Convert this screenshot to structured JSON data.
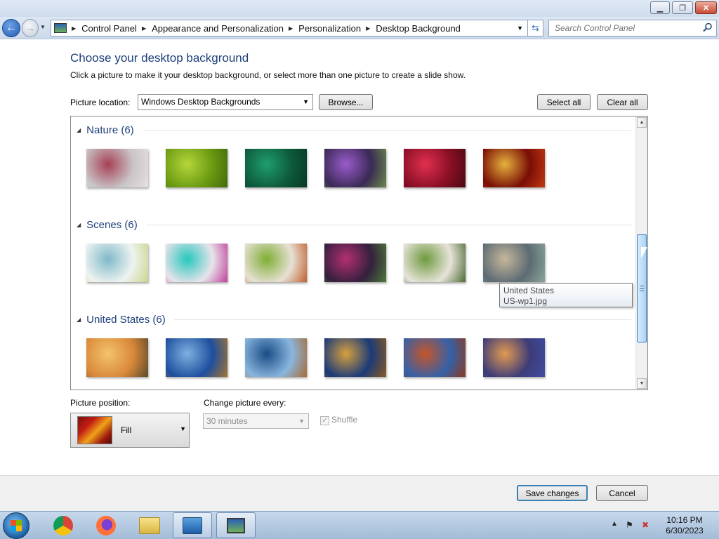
{
  "window": {
    "minimize_label": "▁",
    "maximize_label": "❐",
    "close_label": "✕"
  },
  "address": {
    "breadcrumbs": [
      "Control Panel",
      "Appearance and Personalization",
      "Personalization",
      "Desktop Background"
    ],
    "search_placeholder": "Search Control Panel"
  },
  "main": {
    "heading": "Choose your desktop background",
    "subtext": "Click a picture to make it your desktop background, or select more than one picture to create a slide show.",
    "location_label": "Picture location:",
    "location_value": "Windows Desktop Backgrounds",
    "browse_label": "Browse...",
    "select_all_label": "Select all",
    "clear_all_label": "Clear all"
  },
  "groups": [
    {
      "title": "Nature (6)",
      "thumbnails": [
        [
          "#c9c5c8",
          "#a64155",
          "#e8dfe2"
        ],
        [
          "#6b9a12",
          "#b5d63a",
          "#3f6a0a"
        ],
        [
          "#0d5a3c",
          "#1f9e6d",
          "#073823"
        ],
        [
          "#3a2a55",
          "#9a5ccc",
          "#6b8a4a"
        ],
        [
          "#8a0f25",
          "#e0304f",
          "#4a0812"
        ],
        [
          "#7a0d06",
          "#e5b23c",
          "#c23a12"
        ]
      ]
    },
    {
      "title": "Scenes (6)",
      "thumbnails": [
        [
          "#eef3f0",
          "#7fb9c9",
          "#c9d48a"
        ],
        [
          "#e8e3ea",
          "#26c7bd",
          "#c03f9a"
        ],
        [
          "#e7e0d4",
          "#7fae34",
          "#c0602c"
        ],
        [
          "#34203d",
          "#b42f74",
          "#4c7a3a"
        ],
        [
          "#e7e3d9",
          "#6e9a3e",
          "#4c6a34"
        ],
        [
          "#5c6b73",
          "#c7b79c",
          "#8aa59a"
        ]
      ]
    },
    {
      "title": "United States (6)",
      "thumbnails": [
        [
          "#d9883a",
          "#f3c46a",
          "#5b4a2a"
        ],
        [
          "#1d4f9e",
          "#7fb0e0",
          "#a7742e"
        ],
        [
          "#89b6de",
          "#1a4c86",
          "#a86a36"
        ],
        [
          "#1b3a78",
          "#d8a03e",
          "#8a5a20"
        ],
        [
          "#3461a8",
          "#c6552a",
          "#8c3a1f"
        ],
        [
          "#3d3c78",
          "#e39a50",
          "#3f4da0"
        ]
      ]
    }
  ],
  "tooltip": {
    "line1": "United States",
    "line2": "US-wp1.jpg"
  },
  "options": {
    "position_label": "Picture position:",
    "position_value": "Fill",
    "change_label": "Change picture every:",
    "change_value": "30 minutes",
    "shuffle_label": "Shuffle",
    "shuffle_checked": true
  },
  "footer": {
    "save_label": "Save changes",
    "cancel_label": "Cancel"
  },
  "taskbar": {
    "items": [
      "chrome-icon",
      "firefox-icon",
      "file-explorer-icon",
      "control-panel-icon",
      "desktop-background-icon"
    ],
    "time": "10:16 PM",
    "date": "6/30/2023"
  }
}
